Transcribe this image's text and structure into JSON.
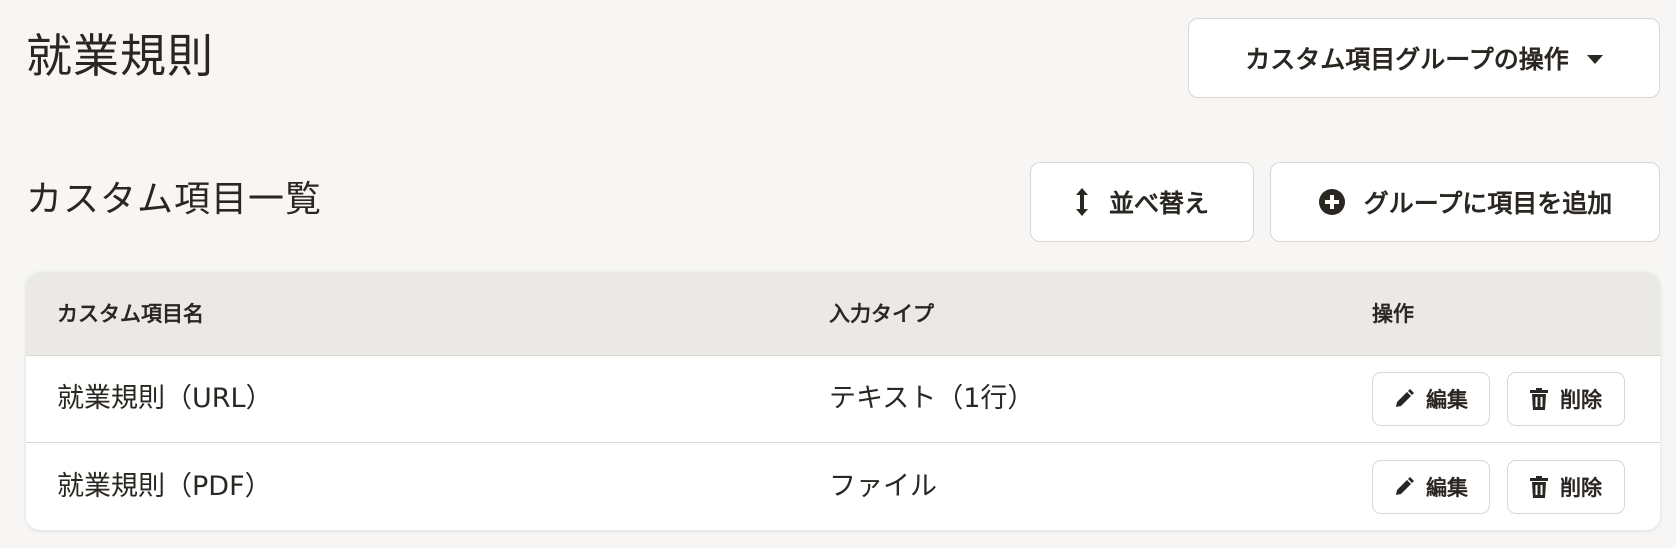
{
  "header": {
    "title": "就業規則",
    "group_actions_label": "カスタム項目グループの操作"
  },
  "section": {
    "title": "カスタム項目一覧",
    "sort_label": "並べ替え",
    "add_label": "グループに項目を追加"
  },
  "table": {
    "columns": [
      "カスタム項目名",
      "入力タイプ",
      "操作"
    ],
    "rows": [
      {
        "name": "就業規則（URL）",
        "type": "テキスト（1行）",
        "edit_label": "編集",
        "delete_label": "削除"
      },
      {
        "name": "就業規則（PDF）",
        "type": "ファイル",
        "edit_label": "編集",
        "delete_label": "削除"
      }
    ]
  },
  "icons": {
    "group_actions": "chevron-down-icon",
    "sort": "sort-arrows-icon",
    "add": "plus-circle-icon",
    "edit": "pencil-icon",
    "delete": "trash-icon"
  },
  "colors": {
    "background": "#f7f6f4",
    "header_row": "#ebe9e5",
    "text": "#2a2622",
    "border": "#d9d6d2"
  }
}
